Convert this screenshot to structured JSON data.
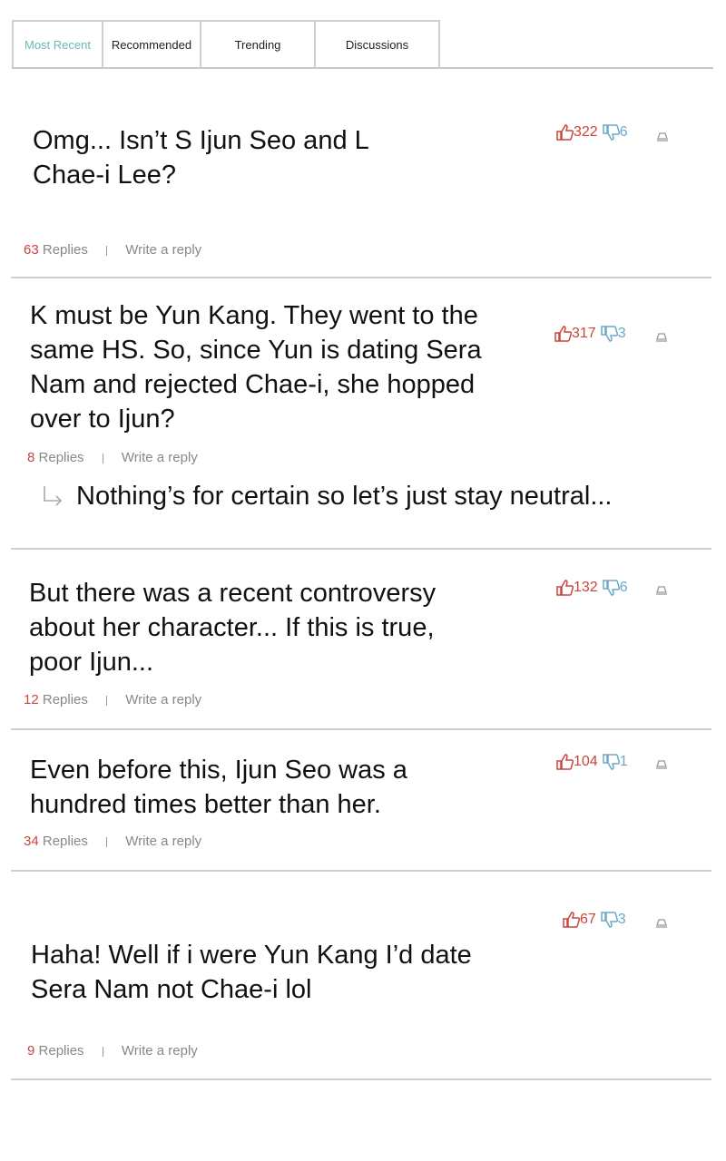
{
  "tabs": [
    "Most Recent",
    "Recommended",
    "Trending",
    "Discussions"
  ],
  "colors": {
    "active_tab": "#6fb7b7",
    "upvote": "#c8463c",
    "downvote": "#6aa8c8",
    "reply_count": "#c8463c"
  },
  "comments": [
    {
      "lines": [
        "Omg... Isn’t S Ijun Seo and L",
        "Chae-i Lee?"
      ],
      "likes": "322",
      "dislikes": "6",
      "replies_count": "63",
      "replies_label": "Replies",
      "reply_action": "Write a reply"
    },
    {
      "lines": [
        "K must be Yun Kang. They went to the",
        "same HS. So, since Yun is dating Sera",
        "Nam and rejected Chae-i, she hopped",
        "over to Ijun?"
      ],
      "likes": "317",
      "dislikes": "3",
      "replies_count": "8",
      "replies_label": "Replies",
      "reply_action": "Write a reply",
      "top_reply": "Nothing’s for certain so let’s just stay neutral..."
    },
    {
      "lines": [
        "But there was a recent controversy",
        "about her character... If this is true,",
        "poor Ijun..."
      ],
      "likes": "132",
      "dislikes": "6",
      "replies_count": "12",
      "replies_label": "Replies",
      "reply_action": "Write a reply"
    },
    {
      "lines": [
        "Even before this, Ijun Seo was a",
        "hundred times better than her."
      ],
      "likes": "104",
      "dislikes": "1",
      "replies_count": "34",
      "replies_label": "Replies",
      "reply_action": "Write a reply"
    },
    {
      "lines": [
        "Haha! Well if i were Yun Kang I’d date",
        "Sera Nam not Chae-i lol"
      ],
      "likes": "67",
      "dislikes": "3",
      "replies_count": "9",
      "replies_label": "Replies",
      "reply_action": "Write a reply"
    }
  ]
}
